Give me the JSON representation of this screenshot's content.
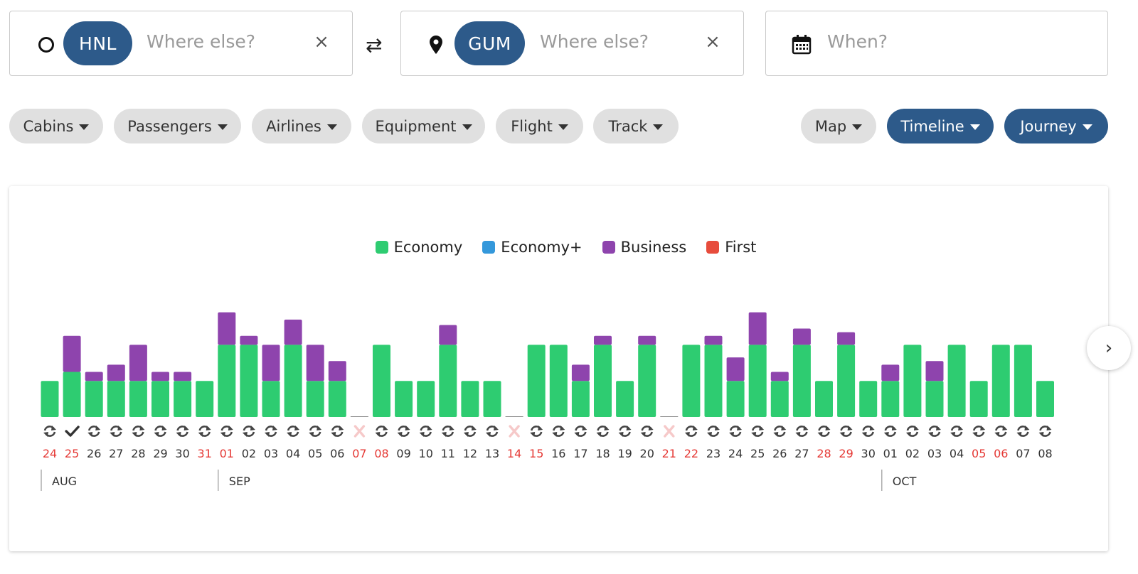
{
  "search": {
    "origin_code": "HNL",
    "origin_placeholder": "Where else?",
    "destination_code": "GUM",
    "destination_placeholder": "Where else?",
    "when_placeholder": "When?",
    "clear_symbol": "×",
    "swap_symbol": "⇄"
  },
  "filters": {
    "cabins": "Cabins",
    "passengers": "Passengers",
    "airlines": "Airlines",
    "equipment": "Equipment",
    "flight": "Flight",
    "track": "Track",
    "map": "Map",
    "timeline": "Timeline",
    "journey": "Journey"
  },
  "colors": {
    "accent": "#2d5a8a",
    "economy": "#2ecc71",
    "economy_plus": "#3498db",
    "business": "#8e44ad",
    "first": "#e74c3c",
    "weekend_date": "#e53935",
    "unavailable_mark": "#f6c9c9"
  },
  "chart_data": {
    "type": "bar",
    "stacked": true,
    "legend": [
      "Economy",
      "Economy+",
      "Business",
      "First"
    ],
    "legend_position": "top-center",
    "months": [
      {
        "label": "AUG",
        "start_index": 0
      },
      {
        "label": "SEP",
        "start_index": 8
      },
      {
        "label": "OCT",
        "start_index": 38
      }
    ],
    "days": [
      {
        "date": "24",
        "economy": 2,
        "business": 0,
        "status": "refresh",
        "red": true
      },
      {
        "date": "25",
        "economy": 2.5,
        "business": 2,
        "status": "check",
        "red": true
      },
      {
        "date": "26",
        "economy": 2,
        "business": 0.5,
        "status": "refresh",
        "red": false
      },
      {
        "date": "27",
        "economy": 2,
        "business": 0.9,
        "status": "refresh",
        "red": false
      },
      {
        "date": "28",
        "economy": 2,
        "business": 2,
        "status": "refresh",
        "red": false
      },
      {
        "date": "29",
        "economy": 2,
        "business": 0.5,
        "status": "refresh",
        "red": false
      },
      {
        "date": "30",
        "economy": 2,
        "business": 0.5,
        "status": "refresh",
        "red": false
      },
      {
        "date": "31",
        "economy": 2,
        "business": 0,
        "status": "refresh",
        "red": true
      },
      {
        "date": "01",
        "economy": 4,
        "business": 1.8,
        "status": "refresh",
        "red": true
      },
      {
        "date": "02",
        "economy": 4,
        "business": 0.5,
        "status": "refresh",
        "red": false
      },
      {
        "date": "03",
        "economy": 2,
        "business": 2,
        "status": "refresh",
        "red": false
      },
      {
        "date": "04",
        "economy": 4,
        "business": 1.4,
        "status": "refresh",
        "red": false
      },
      {
        "date": "05",
        "economy": 2,
        "business": 2,
        "status": "refresh",
        "red": false
      },
      {
        "date": "06",
        "economy": 2,
        "business": 1.1,
        "status": "refresh",
        "red": false
      },
      {
        "date": "07",
        "economy": 0,
        "business": 0,
        "status": "unavailable",
        "red": true
      },
      {
        "date": "08",
        "economy": 4,
        "business": 0,
        "status": "refresh",
        "red": true
      },
      {
        "date": "09",
        "economy": 2,
        "business": 0,
        "status": "refresh",
        "red": false
      },
      {
        "date": "10",
        "economy": 2,
        "business": 0,
        "status": "refresh",
        "red": false
      },
      {
        "date": "11",
        "economy": 4,
        "business": 1.1,
        "status": "refresh",
        "red": false
      },
      {
        "date": "12",
        "economy": 2,
        "business": 0,
        "status": "refresh",
        "red": false
      },
      {
        "date": "13",
        "economy": 2,
        "business": 0,
        "status": "refresh",
        "red": false
      },
      {
        "date": "14",
        "economy": 0,
        "business": 0,
        "status": "unavailable",
        "red": true
      },
      {
        "date": "15",
        "economy": 4,
        "business": 0,
        "status": "refresh",
        "red": true
      },
      {
        "date": "16",
        "economy": 4,
        "business": 0,
        "status": "refresh",
        "red": false
      },
      {
        "date": "17",
        "economy": 2,
        "business": 0.9,
        "status": "refresh",
        "red": false
      },
      {
        "date": "18",
        "economy": 4,
        "business": 0.5,
        "status": "refresh",
        "red": false
      },
      {
        "date": "19",
        "economy": 2,
        "business": 0,
        "status": "refresh",
        "red": false
      },
      {
        "date": "20",
        "economy": 4,
        "business": 0.5,
        "status": "refresh",
        "red": false
      },
      {
        "date": "21",
        "economy": 0,
        "business": 0,
        "status": "unavailable",
        "red": true
      },
      {
        "date": "22",
        "economy": 4,
        "business": 0,
        "status": "refresh",
        "red": true
      },
      {
        "date": "23",
        "economy": 4,
        "business": 0.5,
        "status": "refresh",
        "red": false
      },
      {
        "date": "24",
        "economy": 2,
        "business": 1.3,
        "status": "refresh",
        "red": false
      },
      {
        "date": "25",
        "economy": 4,
        "business": 1.8,
        "status": "refresh",
        "red": false
      },
      {
        "date": "26",
        "economy": 2,
        "business": 0.5,
        "status": "refresh",
        "red": false
      },
      {
        "date": "27",
        "economy": 4,
        "business": 0.9,
        "status": "refresh",
        "red": false
      },
      {
        "date": "28",
        "economy": 2,
        "business": 0,
        "status": "refresh",
        "red": true
      },
      {
        "date": "29",
        "economy": 4,
        "business": 0.7,
        "status": "refresh",
        "red": true
      },
      {
        "date": "30",
        "economy": 2,
        "business": 0,
        "status": "refresh",
        "red": false
      },
      {
        "date": "01",
        "economy": 2,
        "business": 0.9,
        "status": "refresh",
        "red": false
      },
      {
        "date": "02",
        "economy": 4,
        "business": 0,
        "status": "refresh",
        "red": false
      },
      {
        "date": "03",
        "economy": 2,
        "business": 1.1,
        "status": "refresh",
        "red": false
      },
      {
        "date": "04",
        "economy": 4,
        "business": 0,
        "status": "refresh",
        "red": false
      },
      {
        "date": "05",
        "economy": 2,
        "business": 0,
        "status": "refresh",
        "red": true
      },
      {
        "date": "06",
        "economy": 4,
        "business": 0,
        "status": "refresh",
        "red": true
      },
      {
        "date": "07",
        "economy": 4,
        "business": 0,
        "status": "refresh",
        "red": false
      },
      {
        "date": "08",
        "economy": 2,
        "business": 0,
        "status": "refresh",
        "red": false
      }
    ]
  },
  "chart_nav": {
    "next_symbol": "›"
  }
}
